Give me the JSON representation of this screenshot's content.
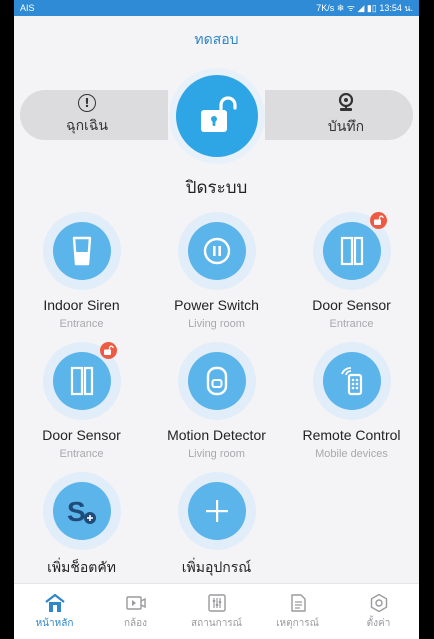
{
  "status_bar": {
    "carrier": "AIS",
    "indicators": "7K/s ❄ ᯤ ◢ ▮▯ 13:54 น."
  },
  "header": {
    "title": "ทดสอบ"
  },
  "arm_control": {
    "left_label": "ฉุกเฉิน",
    "right_label": "บันทึก",
    "state_label": "ปิดระบบ",
    "main_icon": "unlock-icon"
  },
  "devices": [
    {
      "name": "Indoor Siren",
      "room": "Entrance",
      "icon": "siren-icon"
    },
    {
      "name": "Power Switch",
      "room": "Living room",
      "icon": "power-switch-icon"
    },
    {
      "name": "Door Sensor",
      "room": "Entrance",
      "icon": "door-sensor-icon"
    },
    {
      "name": "Door Sensor",
      "room": "Entrance",
      "icon": "door-sensor-icon"
    },
    {
      "name": "Motion Detector",
      "room": "Living room",
      "icon": "motion-detector-icon"
    },
    {
      "name": "Remote Control",
      "room": "Mobile devices",
      "icon": "remote-control-icon"
    }
  ],
  "add_actions": {
    "add_shortcut": "เพิ่มช็อตคัท",
    "add_device": "เพิ่มอุปกรณ์"
  },
  "nav": [
    {
      "label": "หน้าหลัก",
      "icon": "home-icon",
      "active": true
    },
    {
      "label": "กล้อง",
      "icon": "camera-icon",
      "active": false
    },
    {
      "label": "สถานการณ์",
      "icon": "scene-icon",
      "active": false
    },
    {
      "label": "เหตุการณ์",
      "icon": "events-icon",
      "active": false
    },
    {
      "label": "ตั้งค่า",
      "icon": "settings-icon",
      "active": false
    }
  ],
  "colors": {
    "accent": "#2f86c8",
    "device_fill": "#5bb4ea",
    "alert_badge": "#ee5b43",
    "status_bar": "#2f8bd6"
  }
}
